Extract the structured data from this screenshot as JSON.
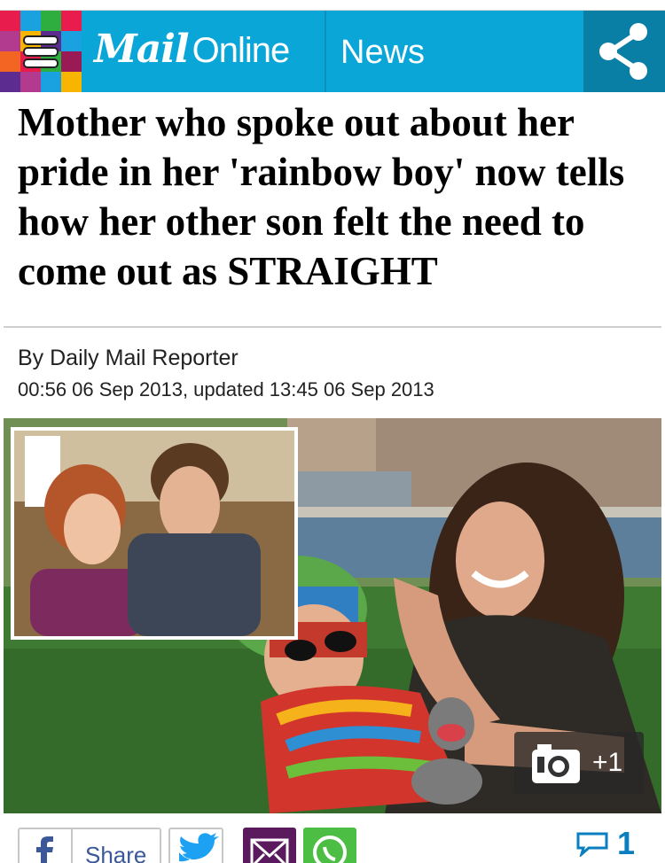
{
  "header": {
    "logo_bold": "Mail",
    "logo_light": "Online",
    "section": "News",
    "brand_color": "#0aa6d8",
    "share_icon": "share-icon",
    "menu_icon": "hamburger-menu-icon"
  },
  "article": {
    "headline": "Mother who spoke out about her pride in her 'rainbow boy' now tells how her other son felt the need to come out as STRAIGHT",
    "byline": "By Daily Mail Reporter",
    "dateline": "00:56 06 Sep 2013, updated 13:45 06 Sep 2013"
  },
  "gallery": {
    "icon": "camera-icon",
    "count": "+1"
  },
  "sharebar": {
    "facebook_label": "Share",
    "facebook_icon": "facebook-icon",
    "twitter_icon": "twitter-icon",
    "email_icon": "email-icon",
    "whatsapp_icon": "whatsapp-icon",
    "comment_icon": "comment-icon",
    "comment_count": "1",
    "facebook_color": "#3b5998",
    "email_color": "#5b1a5e",
    "whatsapp_color": "#4cbe43",
    "comment_color": "#0a7fc0"
  }
}
